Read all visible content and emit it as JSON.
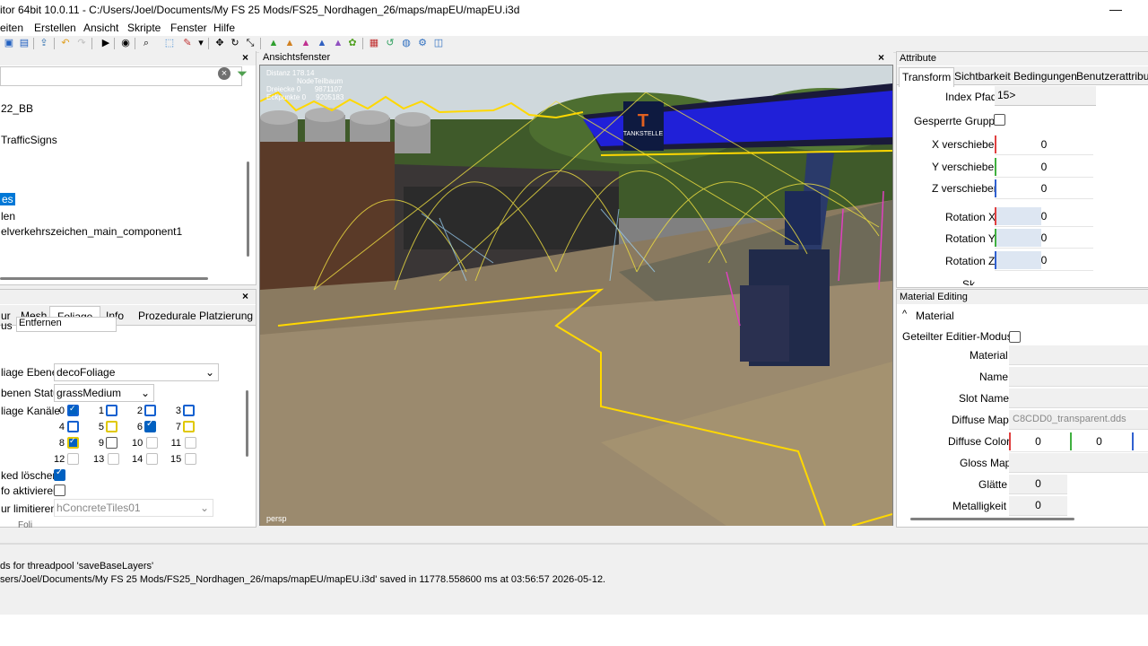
{
  "window": {
    "title": "itor 64bit 10.0.11 - C:/Users/Joel/Documents/My FS 25 Mods/FS25_Nordhagen_26/maps/mapEU/mapEU.i3d",
    "minimize_glyph": "—"
  },
  "menu": [
    "eiten",
    "Erstellen",
    "Ansicht",
    "Skripte",
    "Fenster",
    "Hilfe"
  ],
  "scenegraph": {
    "filter_placeholder": "",
    "items": [
      "22_BB",
      "TrafficSigns",
      "es",
      "len",
      "elverkehrszeichen_main_component1"
    ],
    "selected_index": 2
  },
  "viewport": {
    "title": "Ansichtsfenster",
    "stats": {
      "distance_label": "Distanz",
      "distance_value": "178.14",
      "node_name": "NodeTeilbaum",
      "tris_label": "Dreiecke",
      "tris_col": "0",
      "tris_value": "9871107",
      "verts_label": "Eckpunkte",
      "verts_col": "0",
      "verts_value": "9205183"
    },
    "camera_label": "persp",
    "sign_text": "TANKSTELLE"
  },
  "tools": {
    "tabs": [
      "ur",
      "Mesh",
      "Foliage",
      "Info",
      "Prozedurale Platzierung"
    ],
    "active_tab": "Foliage",
    "mode_value": "Entfernen",
    "mode_label": "us",
    "layer_label": "liage Ebene",
    "layer_value": "decoFoliage",
    "state_label": "benen Status",
    "state_value": "grassMedium",
    "channels_label": "liage Kanäle",
    "channels": [
      "0",
      "1",
      "2",
      "3",
      "4",
      "5",
      "6",
      "7",
      "8",
      "9",
      "10",
      "11",
      "12",
      "13",
      "14",
      "15"
    ],
    "clear_label": "ked löschen",
    "info_label": "fo aktivieren",
    "limit_label": "ur limitieren",
    "limit_value": "hConcreteTiles01",
    "extra_label": "Foli"
  },
  "attributes": {
    "title": "Attribute",
    "tabs": [
      "Transform",
      "Sichtbarkeit Bedingungen",
      "Benutzerattribute"
    ],
    "index_label": "Index Pfad",
    "index_value": "15>",
    "locked_label": "Gesperrte Gruppe",
    "rows": [
      {
        "label": "X verschieben",
        "value": "0"
      },
      {
        "label": "Y verschieben",
        "value": "0"
      },
      {
        "label": "Z verschieben",
        "value": "0"
      },
      {
        "label": "Rotation X",
        "value": "0"
      },
      {
        "label": "Rotation Y",
        "value": "0"
      },
      {
        "label": "Rotation Z",
        "value": "0"
      }
    ],
    "cut_label": "Sk"
  },
  "material": {
    "title": "Material Editing",
    "section": "Material",
    "shared_label": "Geteilter Editier-Modus",
    "material_label": "Material",
    "name_label": "Name",
    "slot_label": "Slot Name",
    "diffuse_map_label": "Diffuse Map",
    "diffuse_map_value": "C8CDD0_transparent.dds",
    "diffuse_color_label": "Diffuse Color",
    "diffuse_color_r": "0",
    "diffuse_color_g": "0",
    "gloss_label": "Gloss Map",
    "smooth_label": "Glätte",
    "smooth_value": "0",
    "metal_label": "Metalligkeit",
    "metal_value": "0"
  },
  "log": {
    "line1": "ds for threadpool 'saveBaseLayers'",
    "line2": "sers/Joel/Documents/My FS 25 Mods/FS25_Nordhagen_26/maps/mapEU/mapEU.i3d' saved in 11778.558600 ms at 03:56:57 2026-05-12."
  },
  "colors": {
    "selection": "#0078d7",
    "axis_x": "#e04040",
    "axis_y": "#40b040",
    "axis_z": "#3060d0"
  }
}
